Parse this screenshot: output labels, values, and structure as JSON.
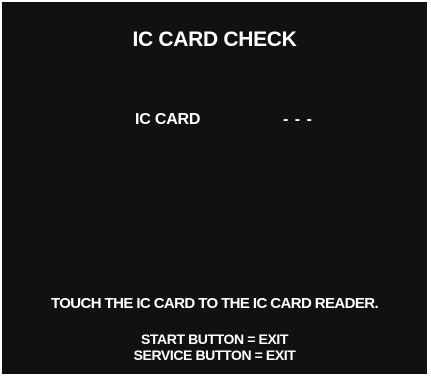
{
  "screen": {
    "title": "IC CARD CHECK",
    "ic_card_label": "IC CARD",
    "ic_card_value": "- - -",
    "instruction": "TOUCH THE IC CARD TO THE IC CARD READER.",
    "exit_lines": [
      "START BUTTON = EXIT",
      "SERVICE BUTTON = EXIT"
    ]
  },
  "colors": {
    "background": "#111111",
    "text": "#ffffff"
  }
}
